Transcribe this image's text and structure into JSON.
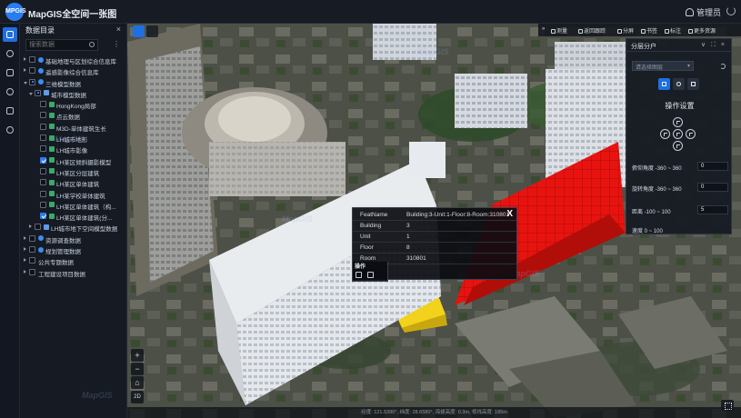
{
  "topbar": {
    "logo_text": "MPGIS",
    "app_title": "MapGIS全空间一张图",
    "user_name": "管理员",
    "icons": {
      "user": "user-icon",
      "power": "power-icon"
    }
  },
  "rail": {
    "items": [
      "catalog-icon",
      "globe-icon",
      "layers-icon",
      "analysis-icon",
      "tools-icon",
      "settings-icon"
    ]
  },
  "catalog": {
    "title": "数据目录",
    "close_label": "×",
    "search_placeholder": "搜索数据",
    "more_label": "⋮",
    "tree": [
      {
        "label": "基础地理与区划综合信息库",
        "depth": 1,
        "arrow": "closed",
        "check": "off",
        "icon": "dot"
      },
      {
        "label": "遥感影像综合信息库",
        "depth": 1,
        "arrow": "closed",
        "check": "off",
        "icon": "dot"
      },
      {
        "label": "三维模型数据",
        "depth": 1,
        "arrow": "open",
        "check": "part",
        "icon": "dot"
      },
      {
        "label": "城市模型数据",
        "depth": 2,
        "arrow": "open",
        "check": "part",
        "icon": "layer"
      },
      {
        "label": "HongKong局部",
        "depth": 3,
        "arrow": "none",
        "check": "off",
        "icon": "green"
      },
      {
        "label": "点云数据",
        "depth": 3,
        "arrow": "none",
        "check": "off",
        "icon": "green"
      },
      {
        "label": "M3D-单体建筑生长",
        "depth": 3,
        "arrow": "none",
        "check": "off",
        "icon": "green"
      },
      {
        "label": "LH城市地形",
        "depth": 3,
        "arrow": "none",
        "check": "off",
        "icon": "green"
      },
      {
        "label": "LH城市影像",
        "depth": 3,
        "arrow": "none",
        "check": "off",
        "icon": "green"
      },
      {
        "label": "LH某区倾斜摄影模型",
        "depth": 3,
        "arrow": "none",
        "check": "on",
        "icon": "green"
      },
      {
        "label": "LH某区分层建筑",
        "depth": 3,
        "arrow": "none",
        "check": "off",
        "icon": "green"
      },
      {
        "label": "LH某区单体建筑",
        "depth": 3,
        "arrow": "none",
        "check": "off",
        "icon": "green"
      },
      {
        "label": "LH某学校单体建筑",
        "depth": 3,
        "arrow": "none",
        "check": "off",
        "icon": "green"
      },
      {
        "label": "LH某区单体建筑（构...",
        "depth": 3,
        "arrow": "none",
        "check": "off",
        "icon": "green"
      },
      {
        "label": "LH某区单体建筑(分...",
        "depth": 3,
        "arrow": "none",
        "check": "on",
        "icon": "green"
      },
      {
        "label": "LH城市地下空间模型数据",
        "depth": 2,
        "arrow": "closed",
        "check": "off",
        "icon": "layer"
      },
      {
        "label": "资源调查数据",
        "depth": 1,
        "arrow": "closed",
        "check": "off",
        "icon": "dot"
      },
      {
        "label": "规划管理数据",
        "depth": 1,
        "arrow": "closed",
        "check": "off",
        "icon": "dot"
      },
      {
        "label": "公共专题数据",
        "depth": 1,
        "arrow": "closed",
        "check": "off",
        "icon": "none"
      },
      {
        "label": "工程建设项目数据",
        "depth": 1,
        "arrow": "closed",
        "check": "off",
        "icon": "none"
      }
    ]
  },
  "map_tools": {
    "locate_icon": "locate-icon",
    "search_icon": "search-icon"
  },
  "toolbar": {
    "items": [
      "测量",
      "返回跟踪",
      "分屏",
      "书签",
      "标注",
      "更多资源"
    ],
    "expand_label": "»"
  },
  "panel": {
    "title": "分层分户",
    "controls": "∨ ⛶ ×",
    "layer_placeholder": "请选择图层",
    "op_title": "操作设置",
    "params": [
      {
        "label": "俯仰角度 -360 ~ 360",
        "value": "0"
      },
      {
        "label": "旋转角度 -360 ~ 360",
        "value": "0"
      },
      {
        "label": "距离 -100 ~ 100",
        "value": "5"
      },
      {
        "label": "速度 0 ~ 100",
        "value": ""
      }
    ]
  },
  "popup": {
    "close_label": "X",
    "rows": [
      {
        "key": "FeatName",
        "value": "Building:3-Unit:1-Floor:8-Room:310801"
      },
      {
        "key": "Building",
        "value": "3"
      },
      {
        "key": "Unit",
        "value": "1"
      },
      {
        "key": "Floor",
        "value": "8"
      },
      {
        "key": "Room",
        "value": "310801"
      }
    ],
    "ops_label": "操作"
  },
  "zoom": {
    "in": "+",
    "out": "−",
    "home": "⌂",
    "mode": "2D"
  },
  "statusbar": {
    "text": "经度: 121.5390°, 纬度: 28.6580°, 海拔高度: 0.3m, 视线高度: 185m"
  },
  "watermark": "MapGIS",
  "colors": {
    "accent": "#1f6fe0",
    "highlight_red": "#e8130f",
    "highlight_yellow": "#f2d21a"
  }
}
